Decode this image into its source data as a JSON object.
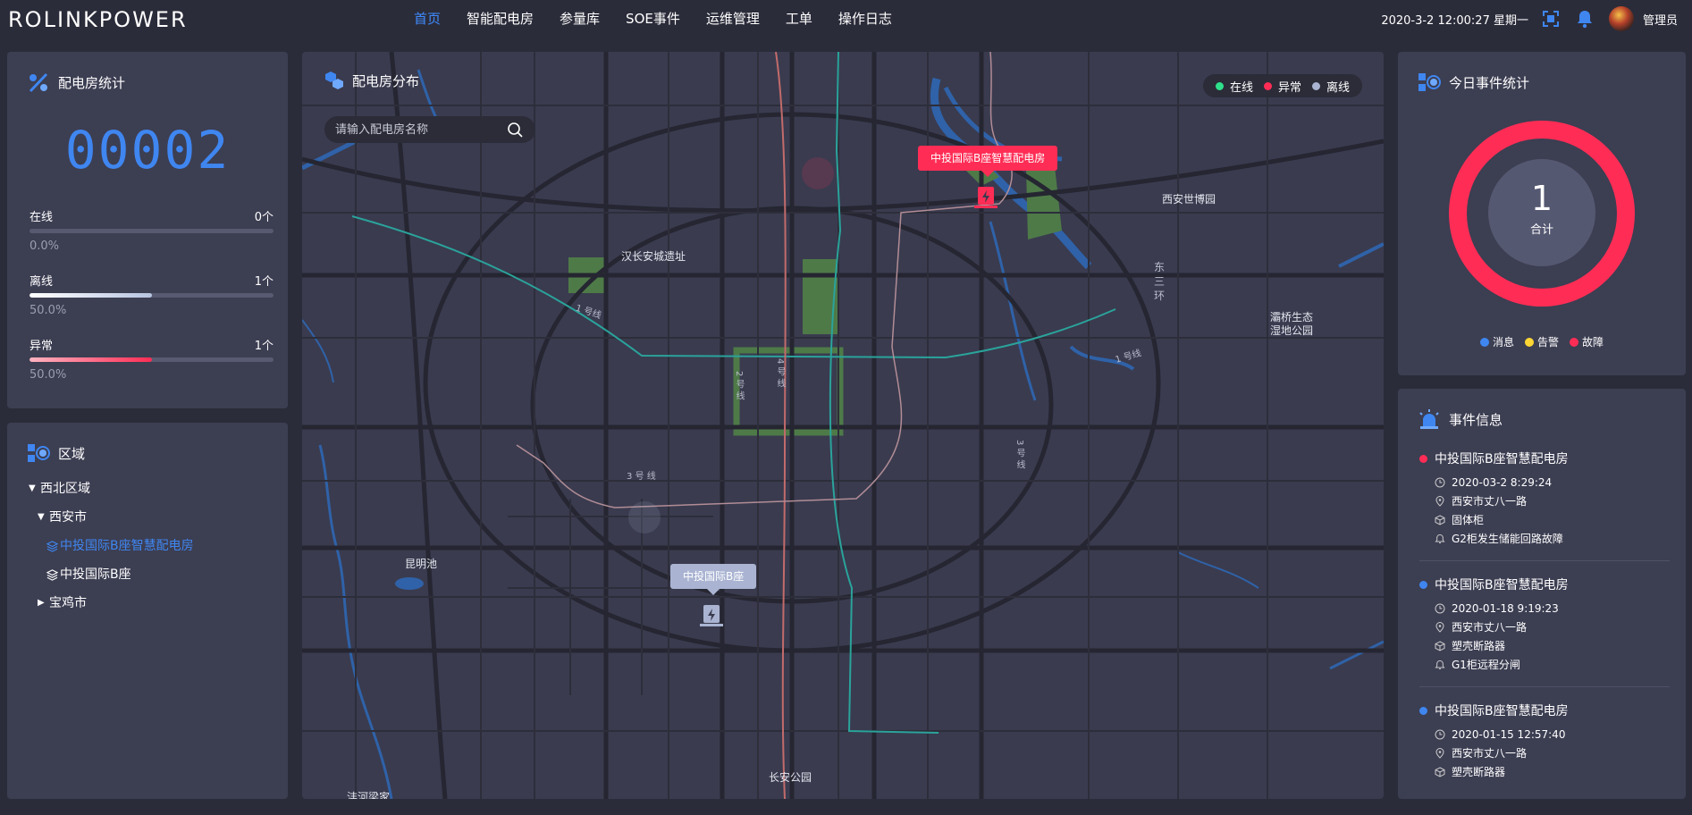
{
  "header": {
    "logo": "ROLINKPOWER",
    "nav": [
      "首页",
      "智能配电房",
      "参量库",
      "SOE事件",
      "运维管理",
      "工单",
      "操作日志"
    ],
    "active_nav": "首页",
    "datetime": "2020-3-2 12:00:27 星期一",
    "user": "管理员",
    "icons": [
      "fullscreen-icon",
      "bell-icon"
    ]
  },
  "stats": {
    "title": "配电房统计",
    "total": "00002",
    "rows": [
      {
        "label": "在线",
        "count": "0个",
        "percent": "0.0%",
        "fill": 0.0,
        "color": "#6fa9ff"
      },
      {
        "label": "离线",
        "count": "1个",
        "percent": "50.0%",
        "fill": 0.5,
        "color": "#b7c3e0"
      },
      {
        "label": "异常",
        "count": "1个",
        "percent": "50.0%",
        "fill": 0.5,
        "color": "#ff2d55"
      }
    ]
  },
  "area": {
    "title": "区域",
    "tree": [
      {
        "label": "西北区域",
        "level": 0,
        "arrow": "down"
      },
      {
        "label": "西安市",
        "level": 1,
        "arrow": "down"
      },
      {
        "label": "中投国际B座智慧配电房",
        "level": 2,
        "arrow": "none",
        "selected": true
      },
      {
        "label": "中投国际B座",
        "level": 2,
        "arrow": "none"
      },
      {
        "label": "宝鸡市",
        "level": 1,
        "arrow": "right"
      }
    ]
  },
  "map": {
    "title": "配电房分布",
    "search_placeholder": "请输入配电房名称",
    "legend": [
      {
        "label": "在线",
        "color": "#2fe08b"
      },
      {
        "label": "异常",
        "color": "#ff2d55"
      },
      {
        "label": "离线",
        "color": "#aab4d2"
      }
    ],
    "labels": [
      "汉长安城遗址",
      "西安世博园",
      "灞桥生态",
      "湿地公园",
      "昆明池",
      "长安公园",
      "沣河梁家",
      "东",
      "三",
      "环"
    ],
    "line_labels": [
      "1 号线",
      "2 号 线",
      "3 号 线",
      "4 号 线"
    ],
    "markers": [
      {
        "name": "中投国际B座智慧配电房",
        "status": "异常",
        "color": "#ff2d55"
      },
      {
        "name": "中投国际B座",
        "status": "离线",
        "color": "#aab4d2"
      }
    ]
  },
  "event_stats": {
    "title": "今日事件统计",
    "total": "1",
    "total_label": "合计",
    "legend": [
      {
        "label": "消息",
        "color": "#3f86f0"
      },
      {
        "label": "告警",
        "color": "#ffd633"
      },
      {
        "label": "故障",
        "color": "#ff2d55"
      }
    ],
    "values": {
      "消息": 0,
      "告警": 0,
      "故障": 1
    }
  },
  "event_info": {
    "title": "事件信息",
    "items": [
      {
        "name": "中投国际B座智慧配电房",
        "dot": "#ff2d55",
        "time": "2020-03-2 8:29:24",
        "location": "西安市丈八一路",
        "device": "固体柜",
        "message": "G2柜发生储能回路故障"
      },
      {
        "name": "中投国际B座智慧配电房",
        "dot": "#3f86f0",
        "time": "2020-01-18 9:19:23",
        "location": "西安市丈八一路",
        "device": "塑壳断路器",
        "message": "G1柜远程分闸"
      },
      {
        "name": "中投国际B座智慧配电房",
        "dot": "#3f86f0",
        "time": "2020-01-15 12:57:40",
        "location": "西安市丈八一路",
        "device": "塑壳断路器",
        "message": ""
      }
    ]
  }
}
